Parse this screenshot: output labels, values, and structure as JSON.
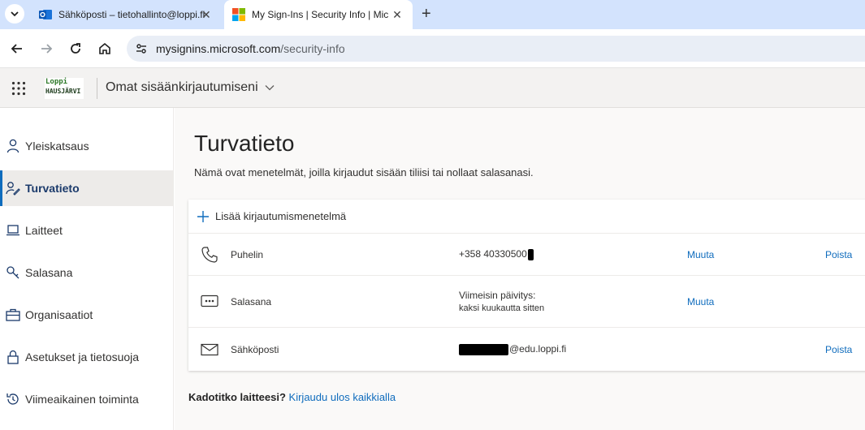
{
  "browser": {
    "tabs": [
      {
        "title": "Sähköposti – tietohallinto@loppi.fi",
        "active": false
      },
      {
        "title": "My Sign-Ins | Security Info | Microsoft",
        "active": true
      }
    ],
    "url_host": "mysignins.microsoft.com",
    "url_path": "/security-info"
  },
  "header": {
    "logo_line1": "Loppi",
    "logo_line2": "HAUSJÄRVI",
    "title": "Omat sisäänkirjautumiseni"
  },
  "sidebar": {
    "items": [
      {
        "label": "Yleiskatsaus",
        "icon": "person-icon",
        "selected": false
      },
      {
        "label": "Turvatieto",
        "icon": "security-info-icon",
        "selected": true
      },
      {
        "label": "Laitteet",
        "icon": "laptop-icon",
        "selected": false
      },
      {
        "label": "Salasana",
        "icon": "key-icon",
        "selected": false
      },
      {
        "label": "Organisaatiot",
        "icon": "briefcase-icon",
        "selected": false
      },
      {
        "label": "Asetukset ja tietosuoja",
        "icon": "lock-icon",
        "selected": false
      },
      {
        "label": "Viimeaikainen toiminta",
        "icon": "history-icon",
        "selected": false
      }
    ]
  },
  "main": {
    "title": "Turvatieto",
    "description": "Nämä ovat menetelmät, joilla kirjaudut sisään tiliisi tai nollaat salasanasi.",
    "add_method_label": "Lisää kirjautumismenetelmä",
    "methods": [
      {
        "name": "Puhelin",
        "value": "+358 40330500",
        "change": "Muuta",
        "delete": "Poista"
      },
      {
        "name": "Salasana",
        "value_line1": "Viimeisin päivitys:",
        "value_line2": "kaksi kuukautta sitten",
        "change": "Muuta"
      },
      {
        "name": "Sähköposti",
        "value": "@edu.loppi.fi",
        "delete": "Poista"
      }
    ],
    "lost_device_question": "Kadotitko laitteesi?",
    "lost_device_link": "Kirjaudu ulos kaikkialla"
  },
  "colors": {
    "accent": "#0f6cbd",
    "tabstrip": "#d3e3fd",
    "header_bg": "#f3f2f1"
  }
}
